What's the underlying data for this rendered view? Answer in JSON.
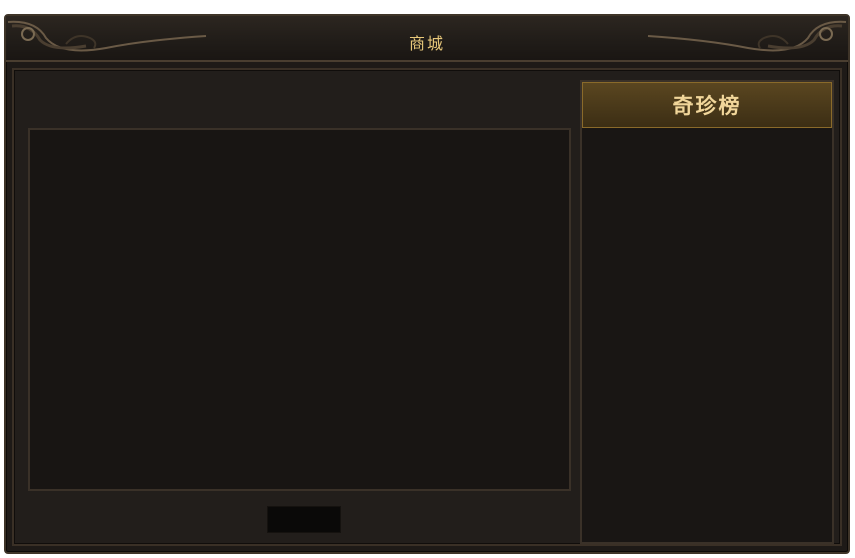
{
  "window": {
    "title": "商城"
  },
  "ranking": {
    "title": "奇珍榜"
  },
  "colors": {
    "title_text": "#e8c87a",
    "panel_bg": "#181513",
    "frame_bg": "#221e1b",
    "accent_gold": "#8a6a2a"
  }
}
